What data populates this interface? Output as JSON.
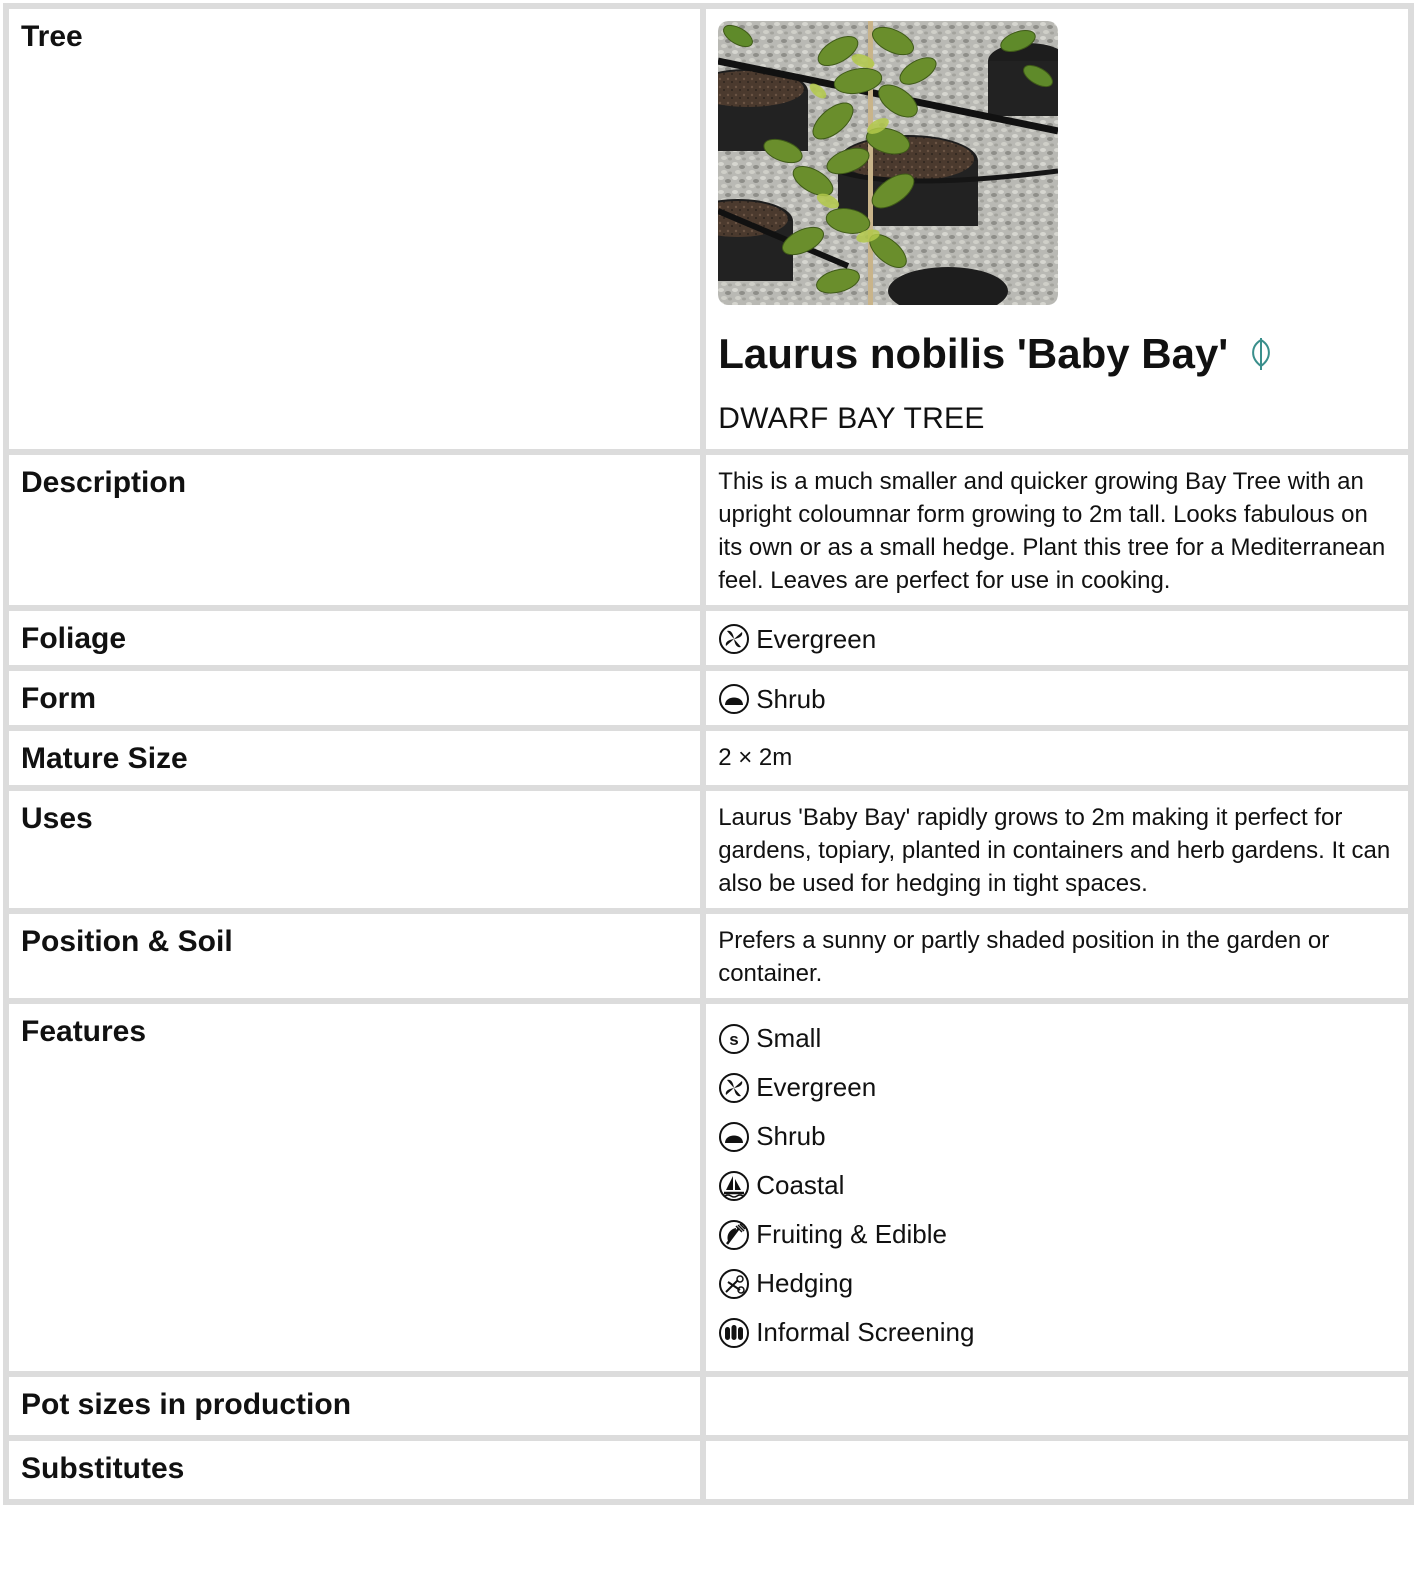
{
  "rows": {
    "tree": {
      "label": "Tree",
      "image_alt": "Laurus nobilis Baby Bay plants in black pots on gravel",
      "botanical_name": "Laurus nobilis 'Baby Bay'",
      "common_name": "DWARF BAY TREE"
    },
    "description": {
      "label": "Description",
      "text": "This is a much smaller and quicker growing Bay Tree with an upright coloumnar form growing to 2m tall. Looks fabulous on its own or as a small hedge. Plant this tree for a Mediterranean feel. Leaves are perfect for use in cooking."
    },
    "foliage": {
      "label": "Foliage",
      "value": "Evergreen",
      "icon": "evergreen-icon"
    },
    "form": {
      "label": "Form",
      "value": "Shrub",
      "icon": "shrub-icon"
    },
    "mature_size": {
      "label": "Mature Size",
      "value": "2 × 2m"
    },
    "uses": {
      "label": "Uses",
      "text": "Laurus 'Baby Bay' rapidly grows to 2m making it perfect for gardens, topiary, planted in containers and herb gardens. It can also be used for hedging in tight spaces."
    },
    "position_soil": {
      "label": "Position & Soil",
      "text": "Prefers a sunny or partly shaded position in the garden or container."
    },
    "features": {
      "label": "Features",
      "items": [
        {
          "label": "Small",
          "icon": "small-icon"
        },
        {
          "label": "Evergreen",
          "icon": "evergreen-icon"
        },
        {
          "label": "Shrub",
          "icon": "shrub-icon"
        },
        {
          "label": "Coastal",
          "icon": "coastal-icon"
        },
        {
          "label": "Fruiting & Edible",
          "icon": "fruiting-edible-icon"
        },
        {
          "label": "Hedging",
          "icon": "hedging-icon"
        },
        {
          "label": "Informal Screening",
          "icon": "informal-screening-icon"
        }
      ]
    },
    "pot_sizes": {
      "label": "Pot sizes in production",
      "value": ""
    },
    "substitutes": {
      "label": "Substitutes",
      "value": ""
    }
  },
  "colors": {
    "accent_teal": "#3a8f8c",
    "border_gray": "#dcdcdc"
  }
}
